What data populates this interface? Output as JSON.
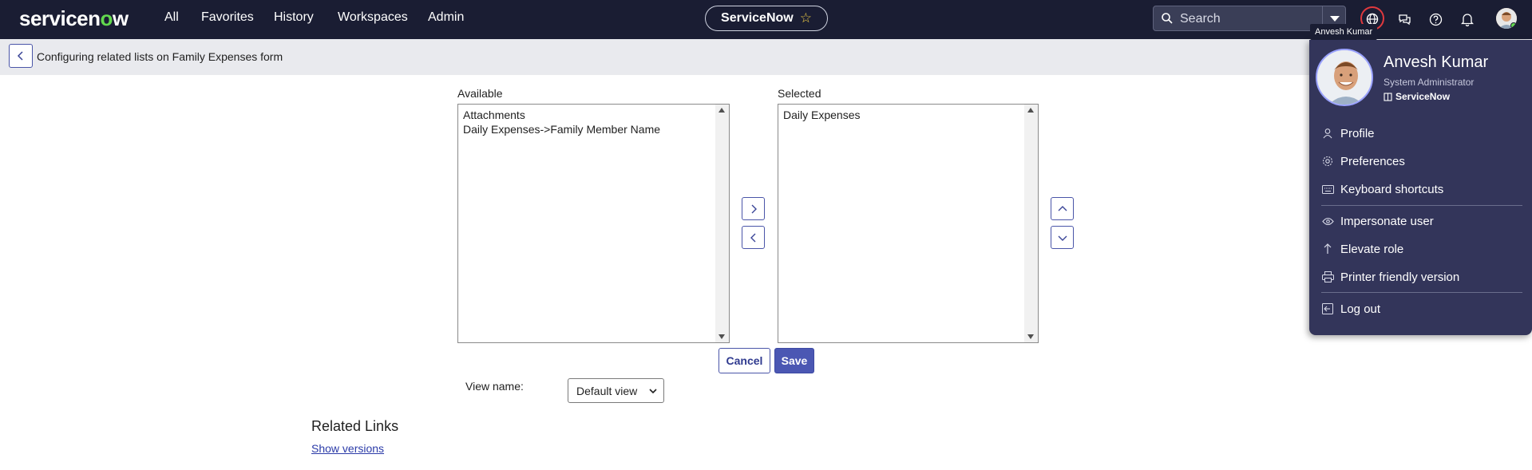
{
  "topbar": {
    "logo": "servicenow",
    "nav": [
      "All",
      "Favorites",
      "History",
      "Workspaces",
      "Admin"
    ],
    "app_pill": "ServiceNow",
    "search_label": "Search"
  },
  "subheader": {
    "title": "Configuring related lists on Family Expenses form"
  },
  "slushbucket": {
    "available_label": "Available",
    "available_options": [
      "Attachments",
      "Daily Expenses->Family Member Name"
    ],
    "selected_label": "Selected",
    "selected_options": [
      "Daily Expenses"
    ]
  },
  "buttons": {
    "cancel": "Cancel",
    "save": "Save"
  },
  "view": {
    "label": "View name:",
    "value": "Default view"
  },
  "related_links": {
    "title": "Related Links",
    "link": "Show versions"
  },
  "tooltip": "Anvesh Kumar",
  "user_menu": {
    "name": "Anvesh Kumar",
    "role": "System Administrator",
    "instance": "ServiceNow",
    "items": [
      {
        "label": "Profile",
        "icon": "person-icon"
      },
      {
        "label": "Preferences",
        "icon": "gear-icon"
      },
      {
        "label": "Keyboard shortcuts",
        "icon": "keyboard-icon"
      },
      {
        "label": "Impersonate user",
        "icon": "eye-icon"
      },
      {
        "label": "Elevate role",
        "icon": "arrow-up-icon"
      },
      {
        "label": "Printer friendly version",
        "icon": "printer-icon"
      },
      {
        "label": "Log out",
        "icon": "logout-icon"
      }
    ]
  },
  "colors": {
    "nav_bg": "#1a1d33",
    "menu_bg": "#33355a",
    "accent": "#4b57b3",
    "brand_green": "#62d84e"
  }
}
